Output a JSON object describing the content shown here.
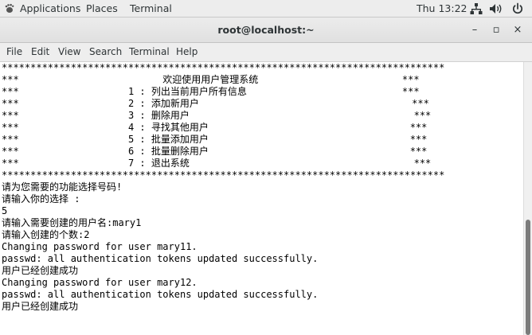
{
  "topbar": {
    "applications": "Applications",
    "places": "Places",
    "terminal": "Terminal",
    "clock": "Thu 13:22"
  },
  "window": {
    "title": "root@localhost:~",
    "minimize": "–",
    "maximize": "▫",
    "close": "×"
  },
  "menu": {
    "file": "File",
    "edit": "Edit",
    "view": "View",
    "search": "Search",
    "terminal": "Terminal",
    "help": "Help"
  },
  "terminal": {
    "lines": [
      "*****************************************************************************",
      "***                         欢迎使用用户管理系统                         ***",
      "***                   1 : 列出当前用户所有信息                           ***",
      "***                   2 : 添加新用户                                     ***",
      "***                   3 : 删除用户                                       ***",
      "***                   4 : 寻找其他用户                                   ***",
      "***                   5 : 批量添加用户                                   ***",
      "***                   6 : 批量删除用户                                   ***",
      "***                   7 : 退出系统                                       ***",
      "*****************************************************************************",
      "请为您需要的功能选择号码!",
      "请输入你的选择 :",
      "5",
      "请输入需要创建的用户名:mary1",
      "请输入创建的个数:2",
      "Changing password for user mary11.",
      "passwd: all authentication tokens updated successfully.",
      "用户已经创建成功",
      "Changing password for user mary12.",
      "passwd: all authentication tokens updated successfully.",
      "用户已经创建成功"
    ]
  },
  "icons": {
    "apps": "gnome-foot-icon",
    "network": "network-icon",
    "volume": "volume-icon",
    "power": "power-icon"
  }
}
